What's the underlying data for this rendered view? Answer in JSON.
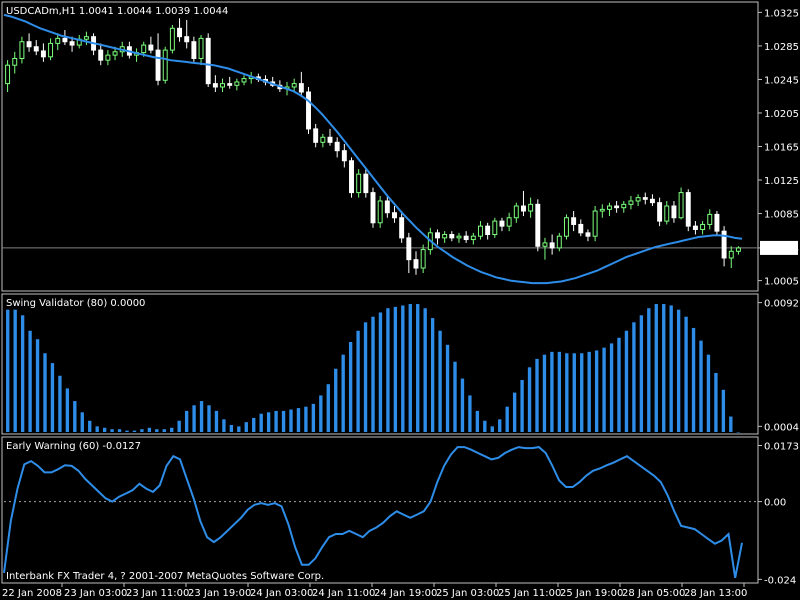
{
  "colors": {
    "background": "#000000",
    "frame": "#c0c0c0",
    "bull_candle": "#7cff7c",
    "bear_candle": "#ffffff",
    "moving_average": "#2e8de8",
    "histogram": "#2e8de8",
    "oscillator": "#2e8de8",
    "last_price_line": "#808080",
    "zero_line": "#a0a0a0"
  },
  "chart_data": [
    {
      "type": "candlestick",
      "title": "USDCADm,H1  1.0041 1.0044 1.0039 1.0044",
      "ylim": [
        0.9995,
        1.0335
      ],
      "yticks": [
        "1.0325",
        "1.0285",
        "1.0245",
        "1.0205",
        "1.0165",
        "1.0125",
        "1.0085",
        "1.0044",
        "1.0005"
      ],
      "ytick_values": [
        1.0325,
        1.0285,
        1.0245,
        1.0205,
        1.0165,
        1.0125,
        1.0085,
        1.0044,
        1.0005
      ],
      "last_price": 1.0044,
      "last_price_label": "1.0044",
      "candles": [
        [
          1.024,
          1.0268,
          1.023,
          1.0262
        ],
        [
          1.0262,
          1.0278,
          1.0252,
          1.027
        ],
        [
          1.027,
          1.0296,
          1.0264,
          1.029
        ],
        [
          1.029,
          1.03,
          1.0278,
          1.0284
        ],
        [
          1.0284,
          1.0292,
          1.0274,
          1.0279
        ],
        [
          1.0279,
          1.0288,
          1.0266,
          1.0272
        ],
        [
          1.0272,
          1.0294,
          1.0268,
          1.0288
        ],
        [
          1.0288,
          1.03,
          1.028,
          1.0294
        ],
        [
          1.0294,
          1.0304,
          1.0286,
          1.029
        ],
        [
          1.029,
          1.0296,
          1.0278,
          1.0286
        ],
        [
          1.0286,
          1.0298,
          1.0282,
          1.0293
        ],
        [
          1.0293,
          1.0302,
          1.0286,
          1.0296
        ],
        [
          1.0296,
          1.03,
          1.0274,
          1.028
        ],
        [
          1.028,
          1.0288,
          1.0262,
          1.0268
        ],
        [
          1.0268,
          1.028,
          1.0262,
          1.0274
        ],
        [
          1.0274,
          1.0284,
          1.0268,
          1.0278
        ],
        [
          1.0278,
          1.029,
          1.0272,
          1.0284
        ],
        [
          1.0284,
          1.029,
          1.027,
          1.0274
        ],
        [
          1.0274,
          1.0282,
          1.0266,
          1.0277
        ],
        [
          1.0277,
          1.029,
          1.0272,
          1.0286
        ],
        [
          1.0286,
          1.0296,
          1.0276,
          1.028
        ],
        [
          1.028,
          1.03,
          1.0238,
          1.0244
        ],
        [
          1.0244,
          1.0284,
          1.024,
          1.028
        ],
        [
          1.028,
          1.031,
          1.0276,
          1.0306
        ],
        [
          1.0306,
          1.0318,
          1.029,
          1.0296
        ],
        [
          1.0296,
          1.0316,
          1.0282,
          1.029
        ],
        [
          1.029,
          1.0296,
          1.0266,
          1.027
        ],
        [
          1.027,
          1.0298,
          1.0262,
          1.0294
        ],
        [
          1.0294,
          1.03,
          1.0236,
          1.024
        ],
        [
          1.024,
          1.025,
          1.023,
          1.0236
        ],
        [
          1.0236,
          1.0246,
          1.023,
          1.024
        ],
        [
          1.024,
          1.0248,
          1.0234,
          1.0238
        ],
        [
          1.0238,
          1.0246,
          1.0232,
          1.0242
        ],
        [
          1.0242,
          1.025,
          1.0238,
          1.0246
        ],
        [
          1.0246,
          1.0254,
          1.024,
          1.0248
        ],
        [
          1.0248,
          1.0252,
          1.0242,
          1.0245
        ],
        [
          1.0245,
          1.025,
          1.0238,
          1.0242
        ],
        [
          1.0242,
          1.0248,
          1.0236,
          1.0238
        ],
        [
          1.0238,
          1.0244,
          1.023,
          1.0234
        ],
        [
          1.0234,
          1.0242,
          1.0226,
          1.0236
        ],
        [
          1.0236,
          1.0246,
          1.023,
          1.024
        ],
        [
          1.024,
          1.0254,
          1.0226,
          1.023
        ],
        [
          1.023,
          1.0236,
          1.018,
          1.0186
        ],
        [
          1.0186,
          1.0192,
          1.0164,
          1.017
        ],
        [
          1.017,
          1.018,
          1.0164,
          1.0176
        ],
        [
          1.0176,
          1.0186,
          1.0166,
          1.017
        ],
        [
          1.017,
          1.0176,
          1.0152,
          1.016
        ],
        [
          1.016,
          1.0168,
          1.014,
          1.0148
        ],
        [
          1.0148,
          1.0152,
          1.0104,
          1.011
        ],
        [
          1.011,
          1.0138,
          1.0104,
          1.0132
        ],
        [
          1.0132,
          1.0138,
          1.0104,
          1.011
        ],
        [
          1.011,
          1.0116,
          1.0068,
          1.0074
        ],
        [
          1.0074,
          1.0106,
          1.0068,
          1.01
        ],
        [
          1.01,
          1.0106,
          1.008,
          1.0086
        ],
        [
          1.0086,
          1.0094,
          1.0074,
          1.008
        ],
        [
          1.008,
          1.0088,
          1.005,
          1.0056
        ],
        [
          1.0056,
          1.0062,
          1.0014,
          1.003
        ],
        [
          1.003,
          1.004,
          1.0012,
          1.002
        ],
        [
          1.002,
          1.0048,
          1.0014,
          1.0042
        ],
        [
          1.0042,
          1.0068,
          1.0036,
          1.0062
        ],
        [
          1.0062,
          1.0066,
          1.0048,
          1.0056
        ],
        [
          1.0056,
          1.0064,
          1.005,
          1.006
        ],
        [
          1.006,
          1.0064,
          1.0052,
          1.0056
        ],
        [
          1.0056,
          1.0062,
          1.005,
          1.0058
        ],
        [
          1.0058,
          1.0064,
          1.005,
          1.0054
        ],
        [
          1.0054,
          1.0062,
          1.0048,
          1.0058
        ],
        [
          1.0058,
          1.0076,
          1.0054,
          1.007
        ],
        [
          1.007,
          1.0074,
          1.0054,
          1.006
        ],
        [
          1.006,
          1.008,
          1.0056,
          1.0076
        ],
        [
          1.0076,
          1.008,
          1.0064,
          1.007
        ],
        [
          1.007,
          1.0086,
          1.0064,
          1.008
        ],
        [
          1.008,
          1.0098,
          1.0074,
          1.0094
        ],
        [
          1.0094,
          1.0112,
          1.0082,
          1.0088
        ],
        [
          1.0088,
          1.0104,
          1.008,
          1.0096
        ],
        [
          1.0096,
          1.0102,
          1.004,
          1.0046
        ],
        [
          1.0046,
          1.0056,
          1.003,
          1.005
        ],
        [
          1.005,
          1.006,
          1.0036,
          1.0044
        ],
        [
          1.0044,
          1.0062,
          1.004,
          1.0058
        ],
        [
          1.0058,
          1.0084,
          1.0054,
          1.008
        ],
        [
          1.008,
          1.0088,
          1.0064,
          1.0072
        ],
        [
          1.0072,
          1.0078,
          1.0058,
          1.0062
        ],
        [
          1.0062,
          1.0066,
          1.0052,
          1.0058
        ],
        [
          1.0058,
          1.0094,
          1.0052,
          1.0088
        ],
        [
          1.0088,
          1.0096,
          1.008,
          1.009
        ],
        [
          1.009,
          1.0098,
          1.0082,
          1.0094
        ],
        [
          1.0094,
          1.01,
          1.0086,
          1.0092
        ],
        [
          1.0092,
          1.01,
          1.0086,
          1.0096
        ],
        [
          1.0096,
          1.0106,
          1.009,
          1.01
        ],
        [
          1.01,
          1.0108,
          1.0094,
          1.0104
        ],
        [
          1.0104,
          1.011,
          1.0096,
          1.0102
        ],
        [
          1.0102,
          1.0108,
          1.0094,
          1.0098
        ],
        [
          1.0098,
          1.0104,
          1.007,
          1.0076
        ],
        [
          1.0076,
          1.01,
          1.0072,
          1.0094
        ],
        [
          1.0094,
          1.01,
          1.0074,
          1.008
        ],
        [
          1.008,
          1.0116,
          1.0078,
          1.011
        ],
        [
          1.011,
          1.0114,
          1.0064,
          1.007
        ],
        [
          1.007,
          1.0076,
          1.006,
          1.0066
        ],
        [
          1.0066,
          1.0076,
          1.006,
          1.0072
        ],
        [
          1.0072,
          1.009,
          1.0066,
          1.0084
        ],
        [
          1.0084,
          1.0088,
          1.006,
          1.0064
        ],
        [
          1.0064,
          1.007,
          1.0022,
          1.0032
        ],
        [
          1.0032,
          1.0046,
          1.002,
          1.004
        ],
        [
          1.004,
          1.0046,
          1.0036,
          1.0044
        ]
      ],
      "ma_name": "",
      "ma_values": [
        1.0322,
        1.032,
        1.0317,
        1.0314,
        1.031,
        1.0306,
        1.0303,
        1.03,
        1.0297,
        1.0295,
        1.0293,
        1.0291,
        1.0289,
        1.0287,
        1.0285,
        1.0283,
        1.0281,
        1.0279,
        1.0277,
        1.0275,
        1.0273,
        1.0271,
        1.027,
        1.0268,
        1.0267,
        1.0266,
        1.0265,
        1.0264,
        1.0263,
        1.0262,
        1.026,
        1.0258,
        1.0255,
        1.0252,
        1.0249,
        1.0246,
        1.0243,
        1.024,
        1.0237,
        1.0234,
        1.0231,
        1.0226,
        1.022,
        1.0212,
        1.0203,
        1.0193,
        1.0183,
        1.0172,
        1.0161,
        1.015,
        1.0139,
        1.0128,
        1.0117,
        1.0106,
        1.0096,
        1.0086,
        1.0077,
        1.0068,
        1.006,
        1.0052,
        1.0045,
        1.0039,
        1.0033,
        1.0028,
        1.0023,
        1.0019,
        1.0015,
        1.0012,
        1.0009,
        1.0007,
        1.0005,
        1.0004,
        1.0003,
        1.0002,
        1.0002,
        1.0002,
        1.0003,
        1.0004,
        1.0006,
        1.0008,
        1.0011,
        1.0014,
        1.0017,
        1.0021,
        1.0025,
        1.0029,
        1.0033,
        1.0036,
        1.0039,
        1.0042,
        1.0045,
        1.0047,
        1.0049,
        1.0051,
        1.0053,
        1.0055,
        1.0057,
        1.0058,
        1.0059,
        1.0059,
        1.0058,
        1.0056,
        1.0055
      ]
    },
    {
      "type": "bar",
      "title": "Swing Validator (80) 0.0000",
      "ylim": [
        0.0,
        0.0096
      ],
      "yticks": [
        "0.0092",
        "0.0004"
      ],
      "ytick_values": [
        0.0092,
        0.0004
      ],
      "values": [
        0.0087,
        0.0087,
        0.0083,
        0.0072,
        0.0066,
        0.0056,
        0.0049,
        0.004,
        0.0031,
        0.0022,
        0.0014,
        0.0008,
        0.0004,
        0.0003,
        0.0002,
        0.0002,
        0.0001,
        0.0001,
        0.0002,
        0.0003,
        0.0002,
        0.0002,
        0.0003,
        0.0008,
        0.0015,
        0.0019,
        0.0022,
        0.0019,
        0.0015,
        0.0009,
        0.0005,
        0.0004,
        0.0007,
        0.001,
        0.0013,
        0.0014,
        0.0015,
        0.0015,
        0.0016,
        0.0017,
        0.0018,
        0.002,
        0.0026,
        0.0034,
        0.0045,
        0.0055,
        0.0064,
        0.0072,
        0.0078,
        0.0082,
        0.0085,
        0.0088,
        0.0089,
        0.009,
        0.0091,
        0.0091,
        0.0088,
        0.0081,
        0.0072,
        0.0062,
        0.005,
        0.0038,
        0.0026,
        0.0015,
        0.0008,
        0.0004,
        0.0009,
        0.0018,
        0.0028,
        0.0037,
        0.0046,
        0.0052,
        0.0055,
        0.0057,
        0.0057,
        0.0056,
        0.0056,
        0.0056,
        0.0057,
        0.0058,
        0.006,
        0.0063,
        0.0067,
        0.0072,
        0.0078,
        0.0083,
        0.0088,
        0.0091,
        0.0091,
        0.009,
        0.0087,
        0.0082,
        0.0074,
        0.0065,
        0.0055,
        0.0042,
        0.003,
        0.0011,
        0.0
      ]
    },
    {
      "type": "line",
      "title": "Early Warning (60) -0.0127",
      "ylim": [
        -0.0245,
        0.019
      ],
      "yticks": [
        "0.0173",
        "0.00",
        "-0.024"
      ],
      "ytick_values": [
        0.0173,
        0.0,
        -0.024
      ],
      "zero_line": 0.0,
      "values": [
        -0.022,
        -0.006,
        0.004,
        0.0115,
        0.0125,
        0.011,
        0.009,
        0.009,
        0.01,
        0.0112,
        0.011,
        0.0095,
        0.007,
        0.005,
        0.003,
        0.001,
        0.0,
        0.0015,
        0.0025,
        0.0035,
        0.0055,
        0.004,
        0.003,
        0.005,
        0.011,
        0.014,
        0.013,
        0.007,
        0.001,
        -0.006,
        -0.011,
        -0.0125,
        -0.011,
        -0.009,
        -0.007,
        -0.005,
        -0.0025,
        -0.001,
        -0.0005,
        -0.001,
        -0.0005,
        -0.0015,
        -0.007,
        -0.014,
        -0.0195,
        -0.0195,
        -0.0175,
        -0.014,
        -0.011,
        -0.01,
        -0.01,
        -0.009,
        -0.01,
        -0.011,
        -0.009,
        -0.008,
        -0.0065,
        -0.0045,
        -0.003,
        -0.004,
        -0.005,
        -0.004,
        -0.003,
        0.0,
        0.006,
        0.011,
        0.0145,
        0.0168,
        0.0168,
        0.016,
        0.015,
        0.014,
        0.013,
        0.0135,
        0.015,
        0.016,
        0.0168,
        0.0165,
        0.0165,
        0.0168,
        0.015,
        0.011,
        0.0065,
        0.0045,
        0.0045,
        0.006,
        0.008,
        0.0095,
        0.0102,
        0.0112,
        0.012,
        0.013,
        0.014,
        0.0125,
        0.011,
        0.0095,
        0.008,
        0.006,
        0.002,
        -0.003,
        -0.0075,
        -0.008,
        -0.0085,
        -0.01,
        -0.0115,
        -0.013,
        -0.012,
        -0.01,
        -0.0235,
        -0.0127
      ]
    }
  ],
  "xaxis": {
    "ticks": [
      "22 Jan 2008",
      "23 Jan 03:00",
      "23 Jan 11:00",
      "23 Jan 19:00",
      "24 Jan 03:00",
      "24 Jan 11:00",
      "24 Jan 19:00",
      "25 Jan 03:00",
      "25 Jan 11:00",
      "25 Jan 19:00",
      "28 Jan 05:00",
      "28 Jan 13:00"
    ]
  },
  "footer": "Interbank FX Trader 4, ? 2001-2007 MetaQuotes Software Corp."
}
